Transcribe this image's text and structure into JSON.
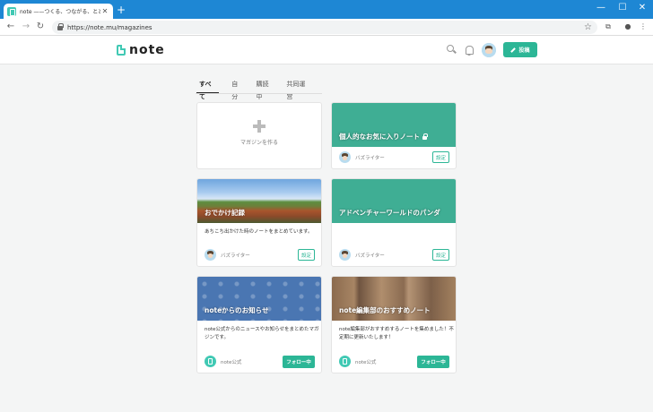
{
  "browser": {
    "tab_title": "note ——つくる、つながる、とどける。",
    "url": "https://note.mu/magazines",
    "window_controls": {
      "minimize": "—",
      "maximize": "☐",
      "close": "✕"
    }
  },
  "header": {
    "logo": "note",
    "post_button": "投稿"
  },
  "filter_tabs": [
    "すべて",
    "自分",
    "購読中",
    "共同運営"
  ],
  "create_card": {
    "label": "マガジンを作る"
  },
  "cards": [
    {
      "title": "個人的なお気に入りノート",
      "author": "バズライター",
      "action": "設定",
      "description": ""
    },
    {
      "title": "おでかけ記録",
      "description": "あちこち出かけた時のノートをまとめています。",
      "author": "バズライター",
      "action": "設定"
    },
    {
      "title": "アドベンチャーワールドのパンダ",
      "description": "",
      "author": "バズライター",
      "action": "設定"
    },
    {
      "title": "noteからのお知らせ",
      "description": "note公式からのニュースやお知らせをまとめたマガジンです。",
      "author": "note公式",
      "action": "フォロー中"
    },
    {
      "title": "note編集部のおすすめノート",
      "description": "note編集部がおすすめするノートを集めました！不定期に更新いたします！",
      "author": "note公式",
      "action": "フォロー中"
    }
  ],
  "colors": {
    "accent": "#2cb696",
    "titlebar": "#1e87d4",
    "brand": "#41c9b4"
  }
}
